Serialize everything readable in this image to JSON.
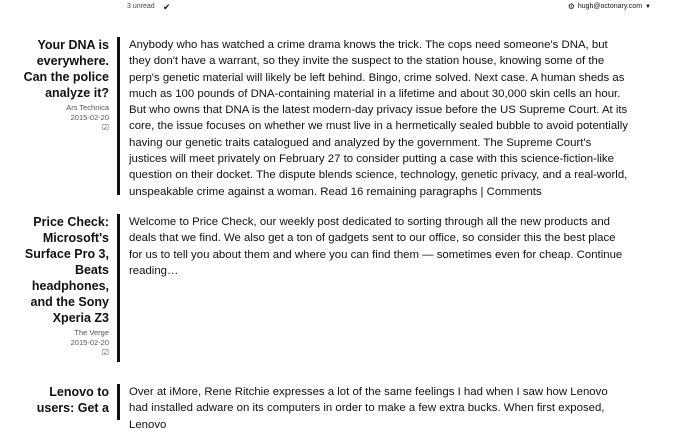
{
  "header": {
    "unread": "3 unread",
    "check_icon": "check-icon",
    "account_icon": "gear-icon",
    "account": "hugh@octonary.com",
    "caret_icon": "caret-down-icon"
  },
  "articles": [
    {
      "title": "Your DNA is everywhere. Can the police analyze it?",
      "title_lines": [
        "Your DNA is",
        "everywhere.",
        "Can the police",
        "analyze it?"
      ],
      "source": "Ars Technica",
      "date": "2015-02-20",
      "mark_icon": "mark-read-icon",
      "body": "Anybody who has watched a crime drama knows the trick. The cops need someone's DNA, but they don't have a warrant, so they invite the suspect to the station house, knowing some of the perp's genetic material will likely be left behind. Bingo, crime solved. Next case. A human sheds as much as 100 pounds of DNA-containing material in a lifetime and about 30,000 skin cells an hour. But who owns that DNA is the latest modern-day privacy issue before the US Supreme Court. At its core, the issue focuses on whether we must live in a hermetically sealed bubble to avoid potentially having our genetic traits catalogued and analyzed by the government. The Supreme Court's justices will meet privately on February 27 to consider putting a case with this science-fiction-like question on their docket. The dispute blends science, technology, genetic privacy, and a real-world, unspeakable crime against a woman.",
      "read_more": "Read 16 remaining paragraphs",
      "separator": "|",
      "comments": "Comments"
    },
    {
      "title": "Price Check: Microsoft's Surface Pro 3, Beats headphones, and the Sony Xperia Z3",
      "title_lines": [
        "Price Check:",
        "Microsoft's",
        "Surface Pro 3,",
        "Beats",
        "headphones,",
        "and the Sony",
        "Xperia Z3"
      ],
      "source": "The Verge",
      "date": "2015-02-20",
      "mark_icon": "mark-read-icon",
      "body": "Welcome to Price Check, our weekly post dedicated to sorting through all the new products and deals that we find. We also get a ton of gadgets sent to our office, so consider this the best place for us to tell you about them and where you can find them — sometimes even for cheap.",
      "read_more": "Continue reading…"
    },
    {
      "title_lines": [
        "Lenovo to",
        "users: Get a"
      ],
      "body_visible": "Over at iMore, Rene Ritchie expresses a lot of the same feelings I had when I saw how Lenovo had installed adware on its computers in order to make a few extra bucks. When first exposed, Lenovo"
    }
  ]
}
